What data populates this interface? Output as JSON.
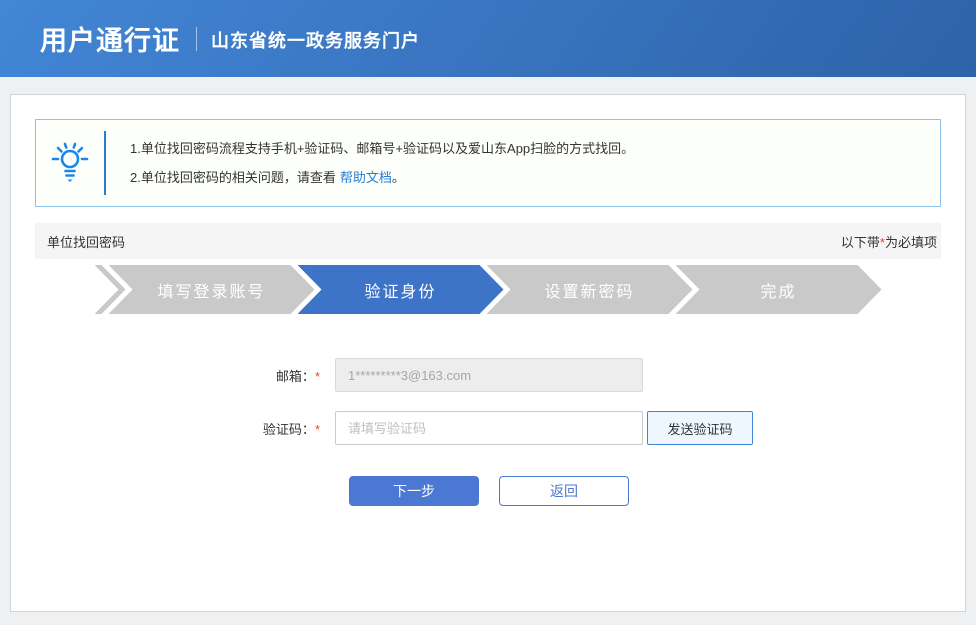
{
  "header": {
    "title": "用户通行证",
    "subtitle": "山东省统一政务服务门户"
  },
  "notice": {
    "line1": "1.单位找回密码流程支持手机+验证码、邮箱号+验证码以及爱山东App扫脸的方式找回。",
    "line2_prefix": "2.单位找回密码的相关问题，请查看",
    "line2_link": "帮助文档",
    "line2_suffix": "。"
  },
  "section": {
    "title": "单位找回密码",
    "required_note_prefix": "以下带",
    "required_star": "*",
    "required_note_suffix": "为必填项"
  },
  "steps": [
    {
      "label": "填写登录账号",
      "state": "inactive"
    },
    {
      "label": "验证身份",
      "state": "active"
    },
    {
      "label": "设置新密码",
      "state": "inactive"
    },
    {
      "label": "完成",
      "state": "inactive"
    }
  ],
  "form": {
    "email": {
      "label": "邮箱：",
      "required_star": "*",
      "value": "1*********3@163.com"
    },
    "code": {
      "label": "验证码：",
      "required_star": "*",
      "placeholder": "请填写验证码",
      "send_button_label": "发送验证码"
    },
    "next_button_label": "下一步",
    "back_button_label": "返回"
  },
  "colors": {
    "header_gradient_start": "#4286d6",
    "header_gradient_end": "#2d63a8",
    "primary_blue": "#4a78d2",
    "step_active_blue": "#3d74c8",
    "step_inactive_gray": "#c9c9c9",
    "link_blue": "#2a7bd3",
    "notice_border_blue": "#8fc3ef",
    "required_red": "#f04134",
    "lightbulb_blue": "#1d87e8"
  }
}
